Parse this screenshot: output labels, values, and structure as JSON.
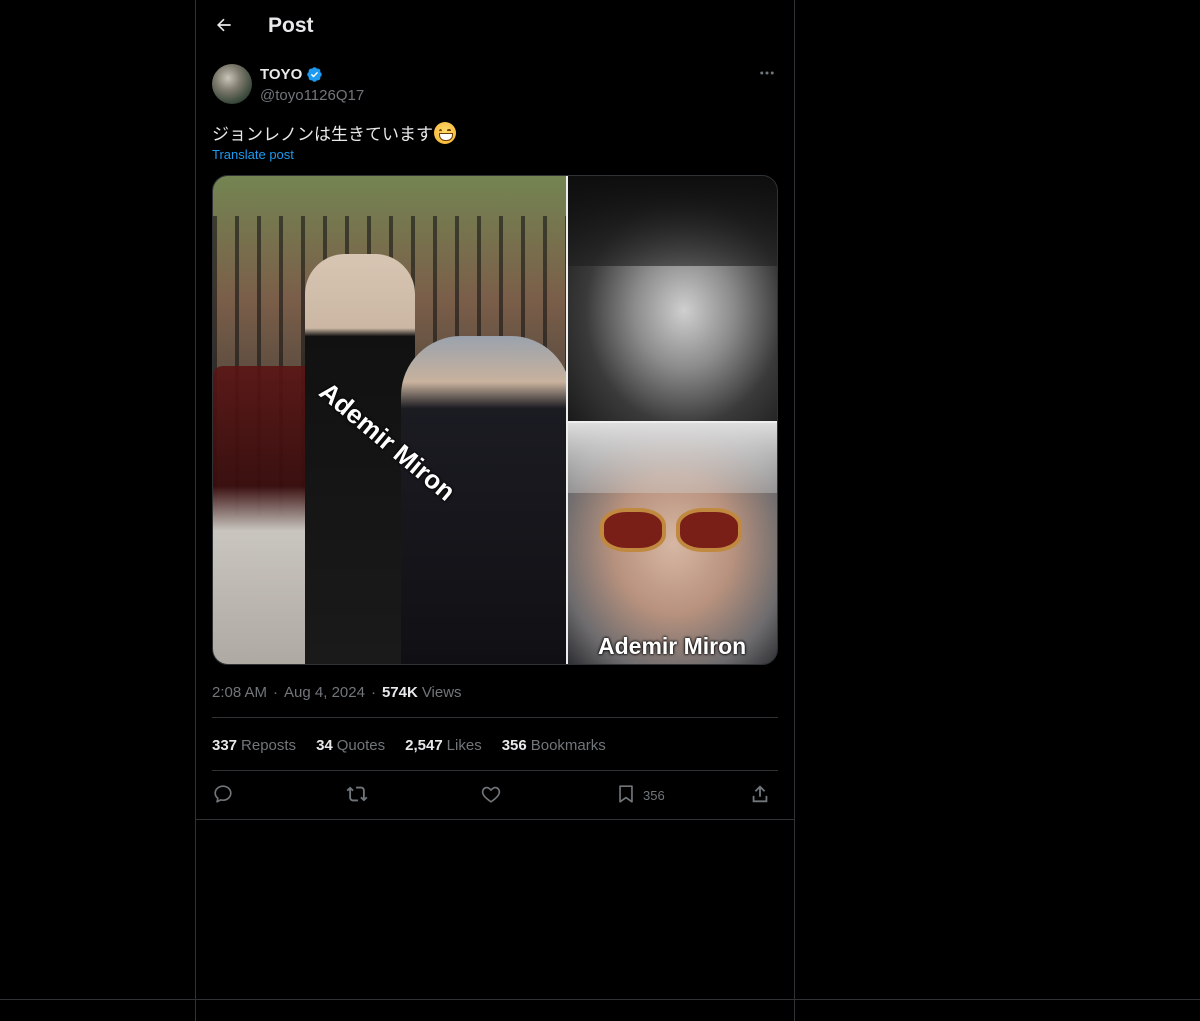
{
  "header": {
    "title": "Post",
    "back_icon": "arrow-left-icon"
  },
  "author": {
    "name": "TOYO",
    "handle": "@toyo1126Q17",
    "verified": true,
    "verified_color": "#1d9bf0"
  },
  "post": {
    "text": "ジョンレノンは生きています",
    "emoji": "grinning-face-icon",
    "translate_label": "Translate post",
    "media": {
      "watermark_left": "Ademir Miron",
      "watermark_right": "Ademir Miron"
    }
  },
  "meta": {
    "time": "2:08 AM",
    "separator": "·",
    "date": "Aug 4, 2024",
    "views_count": "574K",
    "views_label": "Views"
  },
  "stats": [
    {
      "count": "337",
      "label": "Reposts"
    },
    {
      "count": "34",
      "label": "Quotes"
    },
    {
      "count": "2,547",
      "label": "Likes"
    },
    {
      "count": "356",
      "label": "Bookmarks"
    }
  ],
  "actions": {
    "reply_icon": "reply-icon",
    "repost_icon": "repost-icon",
    "like_icon": "heart-icon",
    "bookmark_icon": "bookmark-icon",
    "bookmark_count": "356",
    "share_icon": "share-icon"
  },
  "colors": {
    "background": "#000000",
    "text": "#e7e9ea",
    "secondary": "#71767b",
    "accent": "#1d9bf0",
    "border": "#2f3336"
  }
}
